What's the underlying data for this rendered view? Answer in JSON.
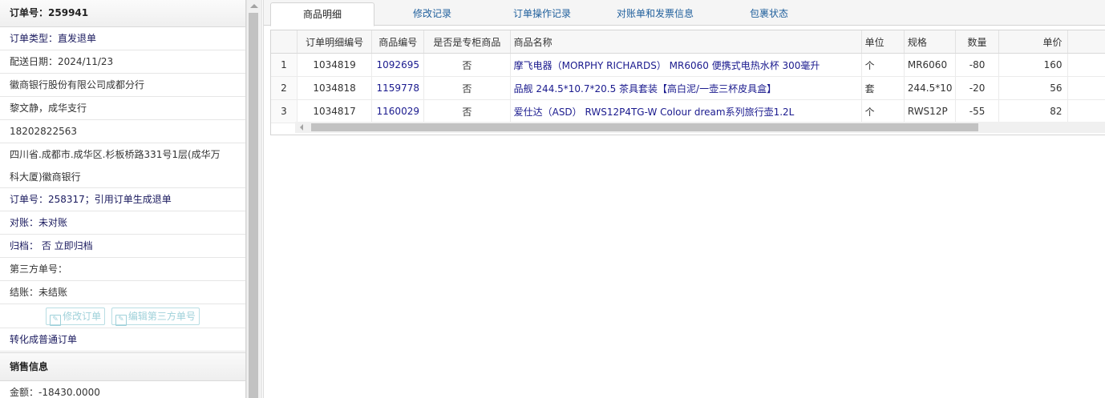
{
  "order": {
    "title_label": "订单号：",
    "title_value": "259941",
    "type": "订单类型：直发退单",
    "delivery_date": "配送日期：2024/11/23",
    "company": "徽商银行股份有限公司成都分行",
    "contact": "黎文静，成华支行",
    "phone": "18202822563",
    "address_line1": "四川省.成都市.成华区.杉板桥路331号1层(成华万",
    "address_line2": "科大厦)徽商银行",
    "ref_order": "订单号：258317；引用订单生成退单",
    "reconcile": "对账：未对账",
    "archive": "归档：  否 立即归档",
    "third_party_no": "第三方单号：",
    "settle": "结账：未结账",
    "edit_order_btn": "修改订单",
    "edit_third_btn": "编辑第三方单号",
    "convert_link": "转化成普通订单",
    "sales_section": "销售信息",
    "amount": "金额：-18430.0000"
  },
  "tabs": [
    {
      "label": "商品明细",
      "active": true
    },
    {
      "label": "修改记录",
      "active": false
    },
    {
      "label": "订单操作记录",
      "active": false
    },
    {
      "label": "对账单和发票信息",
      "active": false
    },
    {
      "label": "包裹状态",
      "active": false
    }
  ],
  "grid": {
    "headers": {
      "idx": "",
      "detail_no": "订单明细编号",
      "product_no": "商品编号",
      "counter": "是否是专柜商品",
      "name": "商品名称",
      "unit": "单位",
      "spec": "规格",
      "qty": "数量",
      "price": "单价"
    },
    "rows": [
      {
        "idx": "1",
        "detail_no": "1034819",
        "product_no": "1092695",
        "counter": "否",
        "name": "摩飞电器（MORPHY RICHARDS） MR6060 便携式电热水杯 300毫升",
        "unit": "个",
        "spec": "MR6060",
        "qty": "-80",
        "price": "160"
      },
      {
        "idx": "2",
        "detail_no": "1034818",
        "product_no": "1159778",
        "counter": "否",
        "name": "品舰 244.5*10.7*20.5 茶具套装【高白泥/一壶三杯皮具盒】",
        "unit": "套",
        "spec": "244.5*10",
        "qty": "-20",
        "price": "56"
      },
      {
        "idx": "3",
        "detail_no": "1034817",
        "product_no": "1160029",
        "counter": "否",
        "name": "爱仕达（ASD） RWS12P4TG-W Colour dream系列旅行壶1.2L",
        "unit": "个",
        "spec": "RWS12P",
        "qty": "-55",
        "price": "82"
      }
    ]
  }
}
